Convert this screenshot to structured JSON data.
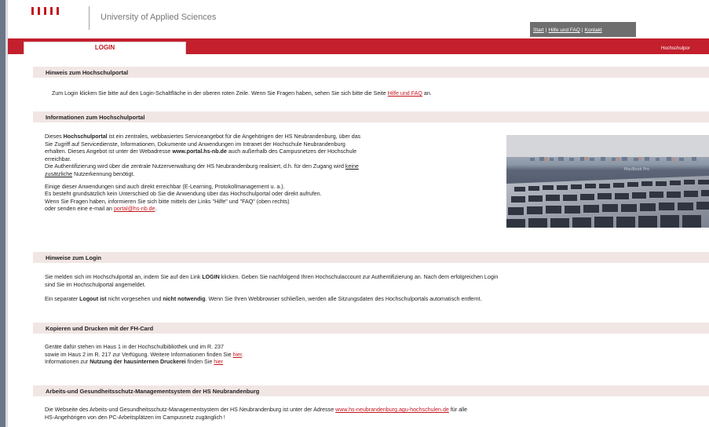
{
  "header": {
    "university": "University of Applied Sciences",
    "nav": {
      "start": "Start",
      "help_faq": "Hilfe und FAQ",
      "contact": "Kontakt",
      "separator": "|"
    }
  },
  "redbar": {
    "login_tab": "LOGIN",
    "right_label": "Hochschulpor"
  },
  "sections": {
    "hinweis": {
      "title": "Hinweis zum Hochschulportal",
      "text_before": "Zum Login klicken Sie bitte auf den Login-Schaltfläche in der oberen roten Zeile. Wenn Sie Fragen haben, sehen Sie sich bitte die Seite ",
      "link": "Hilfe und FAQ",
      "text_after": " an."
    },
    "info": {
      "title": "Informationen zum Hochschulportal",
      "l1_pre": "Dieses ",
      "l1_bold": "Hochschulportal",
      "l1_post": " ist ein zentrales, webbasiertes Serviceangebot für die Angehörigen der HS Neubrandenburg, über das",
      "l2": "Sie Zugriff auf Servicedienste, Informationen, Dokumente und Anwendungen im Intranet der Hochschule Neubrandenburg",
      "l3_pre": "erhalten. Dieses Angebot ist unter der Webadresse ",
      "l3_bold": "www.portal.hs-nb.de",
      "l3_post": " auch außerhalb des Campusnetzes der Hochschule",
      "l4": "erreichbar.",
      "l5_pre": "Die Authentifizierung wird über die zentrale Nutzerverwaltung der HS Neubrandenburg realisiert, d.h. für den Zugang wird ",
      "l5_link": "keine",
      "l6_link": "zusätzliche",
      "l6_post": " Nutzerkennung benötigt.",
      "l7": "Einige dieser Anwendungen sind auch direkt erreichbar (E-Learning, Protokollmanagement u. a.).",
      "l8": "Es besteht grundsätzlich kein Unterschied ob Sie die Anwendung über das Hochschulportal oder direkt aufrufen.",
      "l9": "Wenn Sie Fragen haben, informieren Sie sich bitte mittels der Links \"Hilfe\" und \"FAQ\" (oben rechts)",
      "l10_pre": "oder senden eine e-mail an ",
      "l10_link": "portal@hs-nb.de",
      "l10_post": ".",
      "photo_caption": "MacBook Pro"
    },
    "login": {
      "title": "Hinweise zum Login",
      "l1_pre": "Sie melden sich im Hochschulportal an, indem Sie auf den Link ",
      "l1_bold": "LOGIN",
      "l1_post": " klicken. Geben Sie nachfolgend Ihren Hochschulaccount zur Authentifizierung an. Nach dem erfolgreichen Login",
      "l2": "sind Sie im Hochschulportal angemeldet.",
      "l3_pre": "Ein separater ",
      "l3_bold1": "Logout ist",
      "l3_mid": " nicht vorgesehen und ",
      "l3_bold2": "nicht notwendig",
      "l3_post": ". Wenn Sie Ihren Webbrowser schließen, werden alle Sitzungsdaten des Hochschulportals automatisch entfernt."
    },
    "fhcard": {
      "title": "Kopieren und Drucken mit der FH-Card",
      "l1": "Geräte dafür stehen im Haus 1 in der Hochschulbibliothek und im R. 237",
      "l2_pre": "sowie im Haus 2 im R. 217 zur Verfügung. Weitere Informationen finden Sie ",
      "l2_link": "hier",
      "l2_post": ".",
      "l3_pre": "Informationen zur ",
      "l3_bold": "Nutzung der hausinternen Druckerei",
      "l3_mid": " finden Sie ",
      "l3_link": "hier"
    },
    "agu": {
      "title": "Arbeits-und Gesundheitsschutz-Managementsystem der HS Neubrandenburg",
      "l1_pre": "Die Webseite des Arbeits-und Gesundheitsschutz-Managementsystem der HS Neubrandenburg ist unter der Adresse ",
      "l1_link": "www.hs-neubrandenburg.agu-hochschulen.de",
      "l1_post": " für alle",
      "l2": "HS-Angehörigen von den PC-Arbeitsplätzen im Campusnetz zugänglich !"
    }
  }
}
